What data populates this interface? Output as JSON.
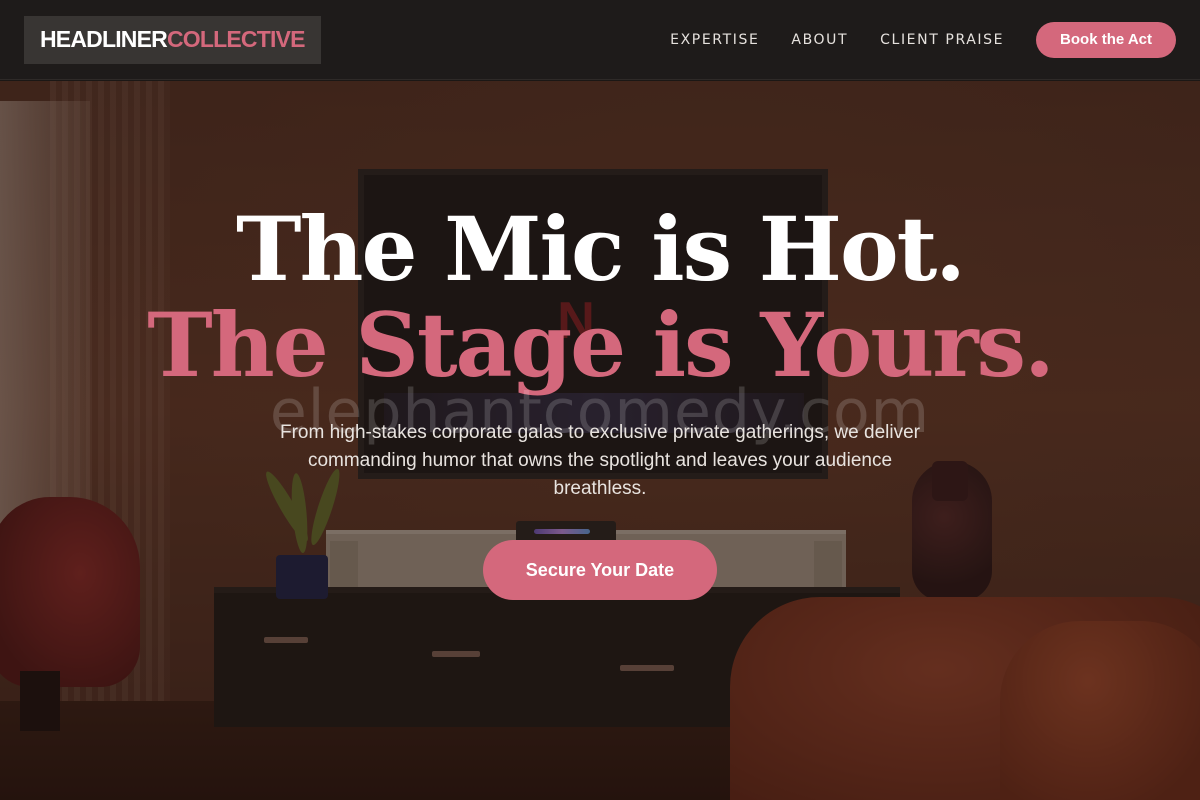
{
  "header": {
    "logo": {
      "part1": "HEADLINER",
      "part2": "COLLECTIVE"
    },
    "nav": [
      {
        "label": "EXPERTISE"
      },
      {
        "label": "ABOUT"
      },
      {
        "label": "CLIENT PRAISE"
      }
    ],
    "cta_label": "Book the Act"
  },
  "hero": {
    "headline_line1": "The Mic is Hot.",
    "headline_line2": "The Stage is Yours.",
    "watermark": "elephantcomedy.com",
    "subtitle": "From high-stakes corporate galas to exclusive private gatherings, we deliver commanding humor that owns the spotlight and leaves your audience breathless.",
    "cta_label": "Secure Your Date",
    "tv_logo": "N"
  },
  "colors": {
    "accent": "#d4687c",
    "header_bg": "#1e1b1a",
    "logo_bg": "#383533"
  }
}
